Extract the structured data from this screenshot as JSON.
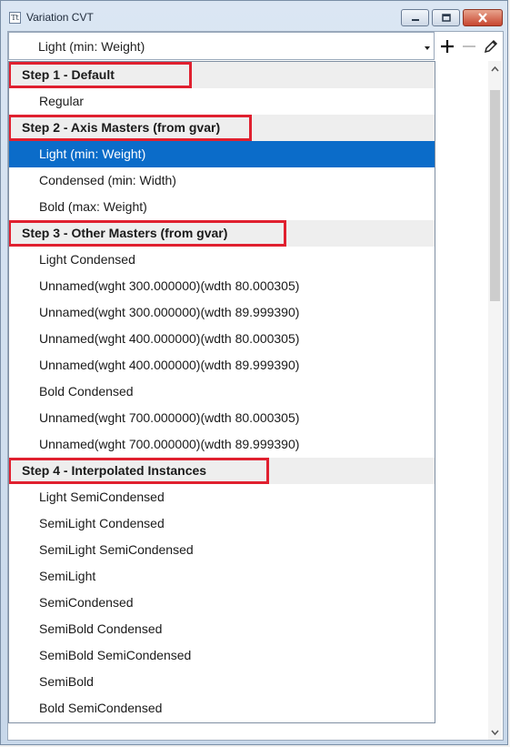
{
  "window": {
    "title": "Variation CVT"
  },
  "combo": {
    "selected": "Light (min: Weight)"
  },
  "dropdown": {
    "rows": [
      {
        "type": "header",
        "label": "Step 1 - Default"
      },
      {
        "type": "item",
        "label": "Regular"
      },
      {
        "type": "header",
        "label": "Step 2 - Axis Masters (from gvar)"
      },
      {
        "type": "item",
        "label": "Light (min: Weight)",
        "selected": true
      },
      {
        "type": "item",
        "label": "Condensed (min: Width)"
      },
      {
        "type": "item",
        "label": "Bold (max: Weight)"
      },
      {
        "type": "header",
        "label": "Step 3 - Other Masters (from gvar)"
      },
      {
        "type": "item",
        "label": "Light Condensed"
      },
      {
        "type": "item",
        "label": "Unnamed(wght 300.000000)(wdth 80.000305)"
      },
      {
        "type": "item",
        "label": "Unnamed(wght 300.000000)(wdth 89.999390)"
      },
      {
        "type": "item",
        "label": "Unnamed(wght 400.000000)(wdth 80.000305)"
      },
      {
        "type": "item",
        "label": "Unnamed(wght 400.000000)(wdth 89.999390)"
      },
      {
        "type": "item",
        "label": "Bold Condensed"
      },
      {
        "type": "item",
        "label": "Unnamed(wght 700.000000)(wdth 80.000305)"
      },
      {
        "type": "item",
        "label": "Unnamed(wght 700.000000)(wdth 89.999390)"
      },
      {
        "type": "header",
        "label": "Step 4 - Interpolated Instances"
      },
      {
        "type": "item",
        "label": "Light SemiCondensed"
      },
      {
        "type": "item",
        "label": "SemiLight Condensed"
      },
      {
        "type": "item",
        "label": "SemiLight SemiCondensed"
      },
      {
        "type": "item",
        "label": "SemiLight"
      },
      {
        "type": "item",
        "label": "SemiCondensed"
      },
      {
        "type": "item",
        "label": "SemiBold Condensed"
      },
      {
        "type": "item",
        "label": "SemiBold SemiCondensed"
      },
      {
        "type": "item",
        "label": "SemiBold"
      },
      {
        "type": "item",
        "label": "Bold SemiCondensed"
      }
    ]
  },
  "icons": {
    "app": "font-icon",
    "minimize": "minimize-icon",
    "maximize": "maximize-icon",
    "close": "close-icon",
    "add": "plus-icon",
    "remove": "minus-icon",
    "edit": "pencil-icon"
  },
  "colors": {
    "selection": "#0b6cc9",
    "highlight_box": "#e0202f",
    "header_bg": "#eeeeee"
  }
}
